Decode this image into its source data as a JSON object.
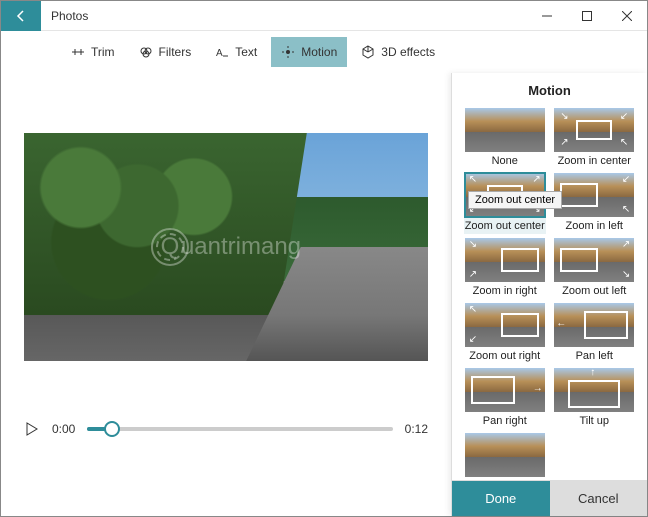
{
  "app": {
    "title": "Photos"
  },
  "toolbar": {
    "trim": "Trim",
    "filters": "Filters",
    "text": "Text",
    "motion": "Motion",
    "effects": "3D effects"
  },
  "player": {
    "current": "0:00",
    "duration": "0:12"
  },
  "panel": {
    "title": "Motion",
    "tooltip": "Zoom out center",
    "items": [
      {
        "label": "None"
      },
      {
        "label": "Zoom in center"
      },
      {
        "label": "Zoom out center"
      },
      {
        "label": "Zoom in left"
      },
      {
        "label": "Zoom in right"
      },
      {
        "label": "Zoom out left"
      },
      {
        "label": "Zoom out right"
      },
      {
        "label": "Pan left"
      },
      {
        "label": "Pan right"
      },
      {
        "label": "Tilt up"
      }
    ],
    "done": "Done",
    "cancel": "Cancel"
  },
  "watermark": "uantrimang"
}
